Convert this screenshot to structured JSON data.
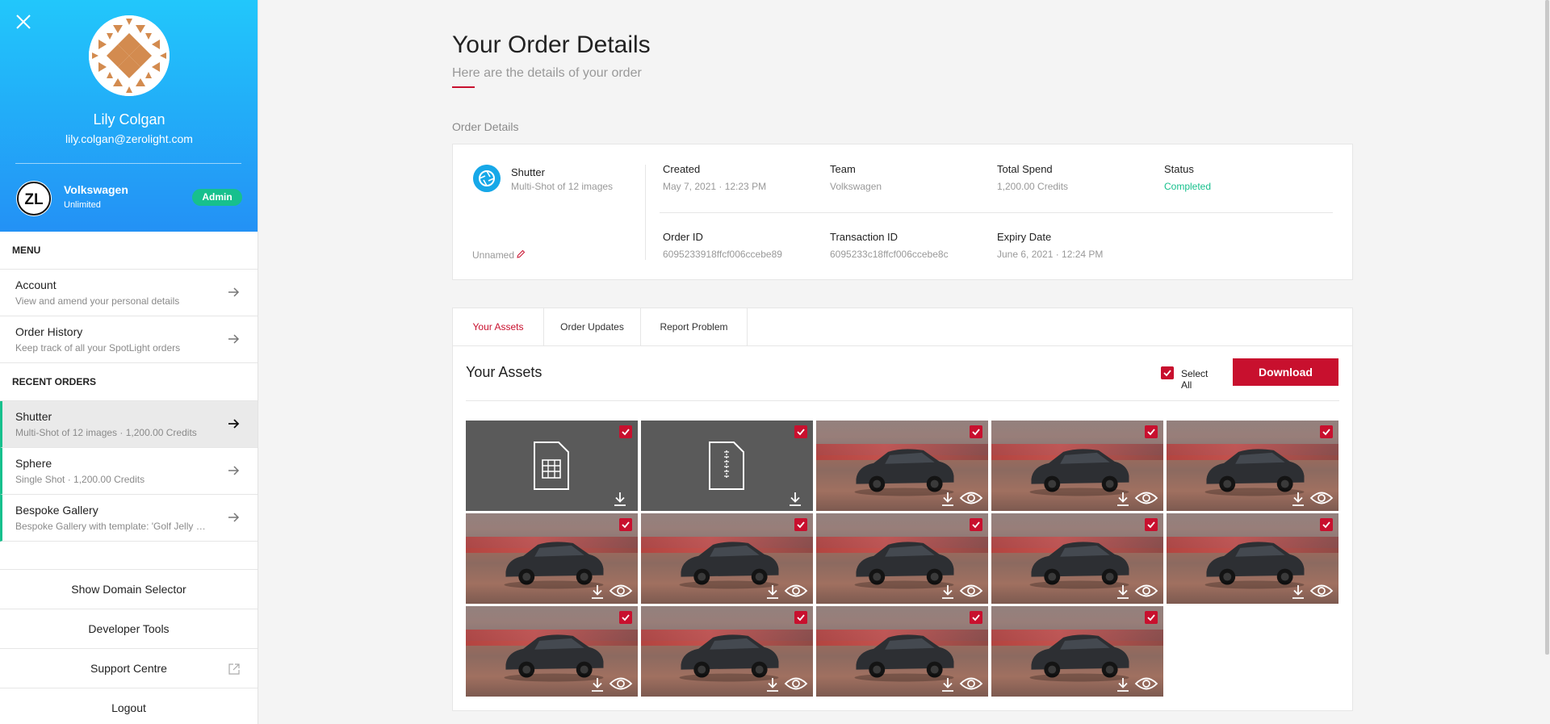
{
  "sidebar": {
    "user_name": "Lily Colgan",
    "user_email": "lily.colgan@zerolight.com",
    "org_name": "Volkswagen",
    "org_plan": "Unlimited",
    "role_badge": "Admin",
    "menu_label": "MENU",
    "menu_items": [
      {
        "title": "Account",
        "sub": "View and amend your personal details"
      },
      {
        "title": "Order History",
        "sub": "Keep track of all your SpotLight orders"
      }
    ],
    "recent_label": "RECENT ORDERS",
    "recent_orders": [
      {
        "title": "Shutter",
        "sub": "Multi-Shot of 12 images · 1,200.00 Credits"
      },
      {
        "title": "Sphere",
        "sub": "Single Shot · 1,200.00 Credits"
      },
      {
        "title": "Bespoke Gallery",
        "sub": "Bespoke Gallery with template: 'Golf Jelly B..."
      }
    ],
    "buttons": [
      "Show Domain Selector",
      "Developer Tools",
      "Support Centre",
      "Logout"
    ]
  },
  "page": {
    "title": "Your Order Details",
    "subtitle": "Here are the details of your order",
    "section_heading": "Order Details"
  },
  "order": {
    "product_name": "Shutter",
    "product_desc": "Multi-Shot of 12 images",
    "order_name": "Unnamed",
    "fields": {
      "created": {
        "label": "Created",
        "value": "May 7, 2021 · 12:23 PM"
      },
      "team": {
        "label": "Team",
        "value": "Volkswagen"
      },
      "total_spend": {
        "label": "Total Spend",
        "value": "1,200.00 Credits"
      },
      "status": {
        "label": "Status",
        "value": "Completed"
      },
      "order_id": {
        "label": "Order ID",
        "value": "6095233918ffcf006ccebe89"
      },
      "transaction_id": {
        "label": "Transaction ID",
        "value": "6095233c18ffcf006ccebe8c"
      },
      "expiry": {
        "label": "Expiry Date",
        "value": "June 6, 2021 · 12:24 PM"
      }
    }
  },
  "assets": {
    "tabs": [
      "Your Assets",
      "Order Updates",
      "Report Problem"
    ],
    "active_tab": "Your Assets",
    "heading": "Your Assets",
    "select_all_label": "Select All",
    "download_label": "Download",
    "tiles": [
      {
        "type": "spreadsheet-file",
        "selected": true
      },
      {
        "type": "zip-file",
        "selected": true
      },
      {
        "type": "image",
        "selected": true
      },
      {
        "type": "image",
        "selected": true
      },
      {
        "type": "image",
        "selected": true
      },
      {
        "type": "image",
        "selected": true
      },
      {
        "type": "image",
        "selected": true
      },
      {
        "type": "image",
        "selected": true
      },
      {
        "type": "image",
        "selected": true
      },
      {
        "type": "image",
        "selected": true
      },
      {
        "type": "image",
        "selected": true
      },
      {
        "type": "image",
        "selected": true
      },
      {
        "type": "image",
        "selected": true
      },
      {
        "type": "image",
        "selected": true
      }
    ]
  },
  "colors": {
    "accent": "#c8102e",
    "success": "#17c08d",
    "header_gradient_top": "#22c7fb",
    "header_gradient_bottom": "#2391f5"
  }
}
